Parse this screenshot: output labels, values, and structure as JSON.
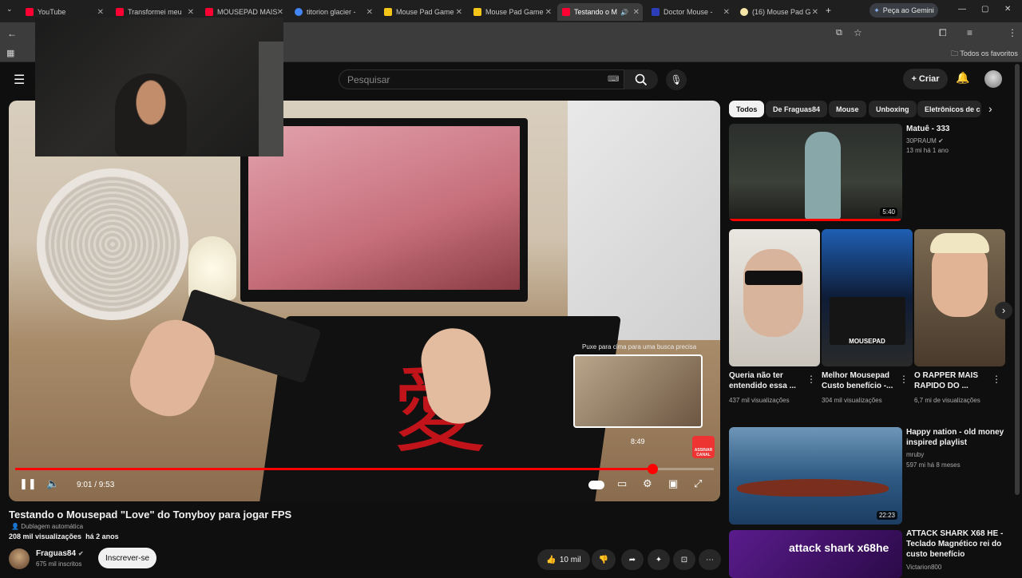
{
  "browser": {
    "tabs": [
      {
        "label": "YouTube",
        "color": "#ff0033"
      },
      {
        "label": "Transformei meu",
        "color": "#ff0033"
      },
      {
        "label": "MOUSEPAD MAIS",
        "color": "#ff0033"
      },
      {
        "label": "titorion glacier -",
        "color": "#4285f4"
      },
      {
        "label": "Mouse Pad Game",
        "color": "#f5c518"
      },
      {
        "label": "Mouse Pad Game",
        "color": "#f5c518"
      },
      {
        "label": "Testando o M",
        "color": "#ff0033"
      },
      {
        "label": "Doctor Mouse -",
        "color": "#2b3db8"
      },
      {
        "label": "(16) Mouse Pad G",
        "color": "#f5e6a8"
      }
    ],
    "gemini_label": "Peça ao Gemini",
    "bookmarks_label": "Todos os favoritos"
  },
  "yt": {
    "search_placeholder": "Pesquisar",
    "create_label": "Criar",
    "player": {
      "time": "9:01 / 9:53",
      "progress": 0.912,
      "preview_time": "8:49",
      "pull_hint": "Puxe para cima para uma busca precisa",
      "subscribe_badge": "ASSINAR CANAL"
    },
    "video": {
      "title": "Testando o Mousepad \"Love\" do Tonyboy para jogar FPS",
      "dubbing": "Dublagem automática",
      "views": "208 mil visualizações",
      "age": "há 2 anos",
      "channel": "Fraguas84",
      "subscribers": "675 mil inscritos",
      "subscribe_label": "Inscrever-se",
      "likes": "10 mil"
    },
    "chips": [
      "Todos",
      "De Fraguas84",
      "Mouse",
      "Unboxing",
      "Eletrônicos de c"
    ],
    "recs": {
      "r1": {
        "title": "Matuê - 333",
        "channel": "30PRAUM",
        "meta": "13 mi  há 1 ano",
        "duration": "5:40"
      },
      "short1": {
        "title": "Queria não ter entendido essa ...",
        "meta": "437 mil visualizações"
      },
      "short2": {
        "title": "Melhor Mousepad Custo benefício -...",
        "meta": "304 mil visualizações",
        "thumb_text": "MOUSEPAD"
      },
      "short3": {
        "title": "O RAPPER MAIS RAPIDO DO ...",
        "meta": "6,7 mi de visualizações"
      },
      "r2": {
        "title": "Happy nation - old money inspired playlist",
        "channel": "mruby",
        "meta": "597 mi  há 8 meses",
        "duration": "22:23"
      },
      "r3": {
        "title": "ATTACK SHARK X68 HE - Teclado Magnético rei do custo benefício",
        "channel": "Victarion800",
        "thumb_text": "attack shark x68he"
      }
    }
  }
}
